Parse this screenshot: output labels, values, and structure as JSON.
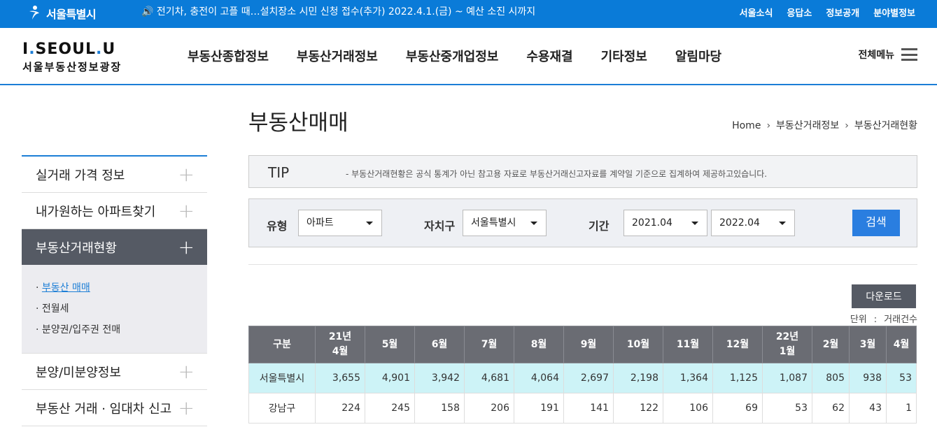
{
  "topbar": {
    "logo": "서울특별시",
    "notice": "전기차, 충전이 고플 때…설치장소 시민 신청 접수(추가) 2022.4.1.(금) ~ 예산 소진 시까지",
    "links": [
      "서울소식",
      "응답소",
      "정보공개",
      "분야별정보"
    ]
  },
  "header": {
    "brand_en_a": "I",
    "brand_en_b": "SEOUL",
    "brand_en_c": "U",
    "brand_ko": "서울부동산정보광장",
    "gnb": [
      "부동산종합정보",
      "부동산거래정보",
      "부동산중개업정보",
      "수용재결",
      "기타정보",
      "알림마당"
    ],
    "allmenu": "전체메뉴"
  },
  "lnb": {
    "items": [
      "실거래 가격 정보",
      "내가원하는 아파트찾기",
      "부동산거래현황",
      "분양/미분양정보",
      "부동산 거래 · 임대차 신고"
    ],
    "sub": [
      "부동산 매매",
      "전월세",
      "분양권/입주권 전매"
    ]
  },
  "page": {
    "title": "부동산매매",
    "breadcrumb": [
      "Home",
      "부동산거래정보",
      "부동산거래현황"
    ]
  },
  "tip": {
    "label": "TIP",
    "text": "-  부동산거래현황은 공식 통계가 아닌 참고용 자료로 부동산거래신고자료를 계약일 기준으로 집계하여 제공하고있습니다."
  },
  "search": {
    "type_label": "유형",
    "type_value": "아파트",
    "district_label": "자치구",
    "district_value": "서울특별시",
    "period_label": "기간",
    "period_from": "2021.04",
    "period_to": "2022.04",
    "button": "검색"
  },
  "download": "다운로드",
  "unit": {
    "label": "단위",
    "colon": ":",
    "value": "거래건수"
  },
  "table": {
    "headers": [
      {
        "l1": "구분",
        "l2": ""
      },
      {
        "l1": "21년",
        "l2": "4월"
      },
      {
        "l1": "5월",
        "l2": ""
      },
      {
        "l1": "6월",
        "l2": ""
      },
      {
        "l1": "7월",
        "l2": ""
      },
      {
        "l1": "8월",
        "l2": ""
      },
      {
        "l1": "9월",
        "l2": ""
      },
      {
        "l1": "10월",
        "l2": ""
      },
      {
        "l1": "11월",
        "l2": ""
      },
      {
        "l1": "12월",
        "l2": ""
      },
      {
        "l1": "22년",
        "l2": "1월"
      },
      {
        "l1": "2월",
        "l2": ""
      },
      {
        "l1": "3월",
        "l2": ""
      },
      {
        "l1": "4월",
        "l2": ""
      }
    ],
    "rows": [
      [
        "서울특별시",
        "3,655",
        "4,901",
        "3,942",
        "4,681",
        "4,064",
        "2,697",
        "2,198",
        "1,364",
        "1,125",
        "1,087",
        "805",
        "938",
        "53"
      ],
      [
        "강남구",
        "224",
        "245",
        "158",
        "206",
        "191",
        "141",
        "122",
        "106",
        "69",
        "53",
        "62",
        "43",
        "1"
      ]
    ]
  }
}
